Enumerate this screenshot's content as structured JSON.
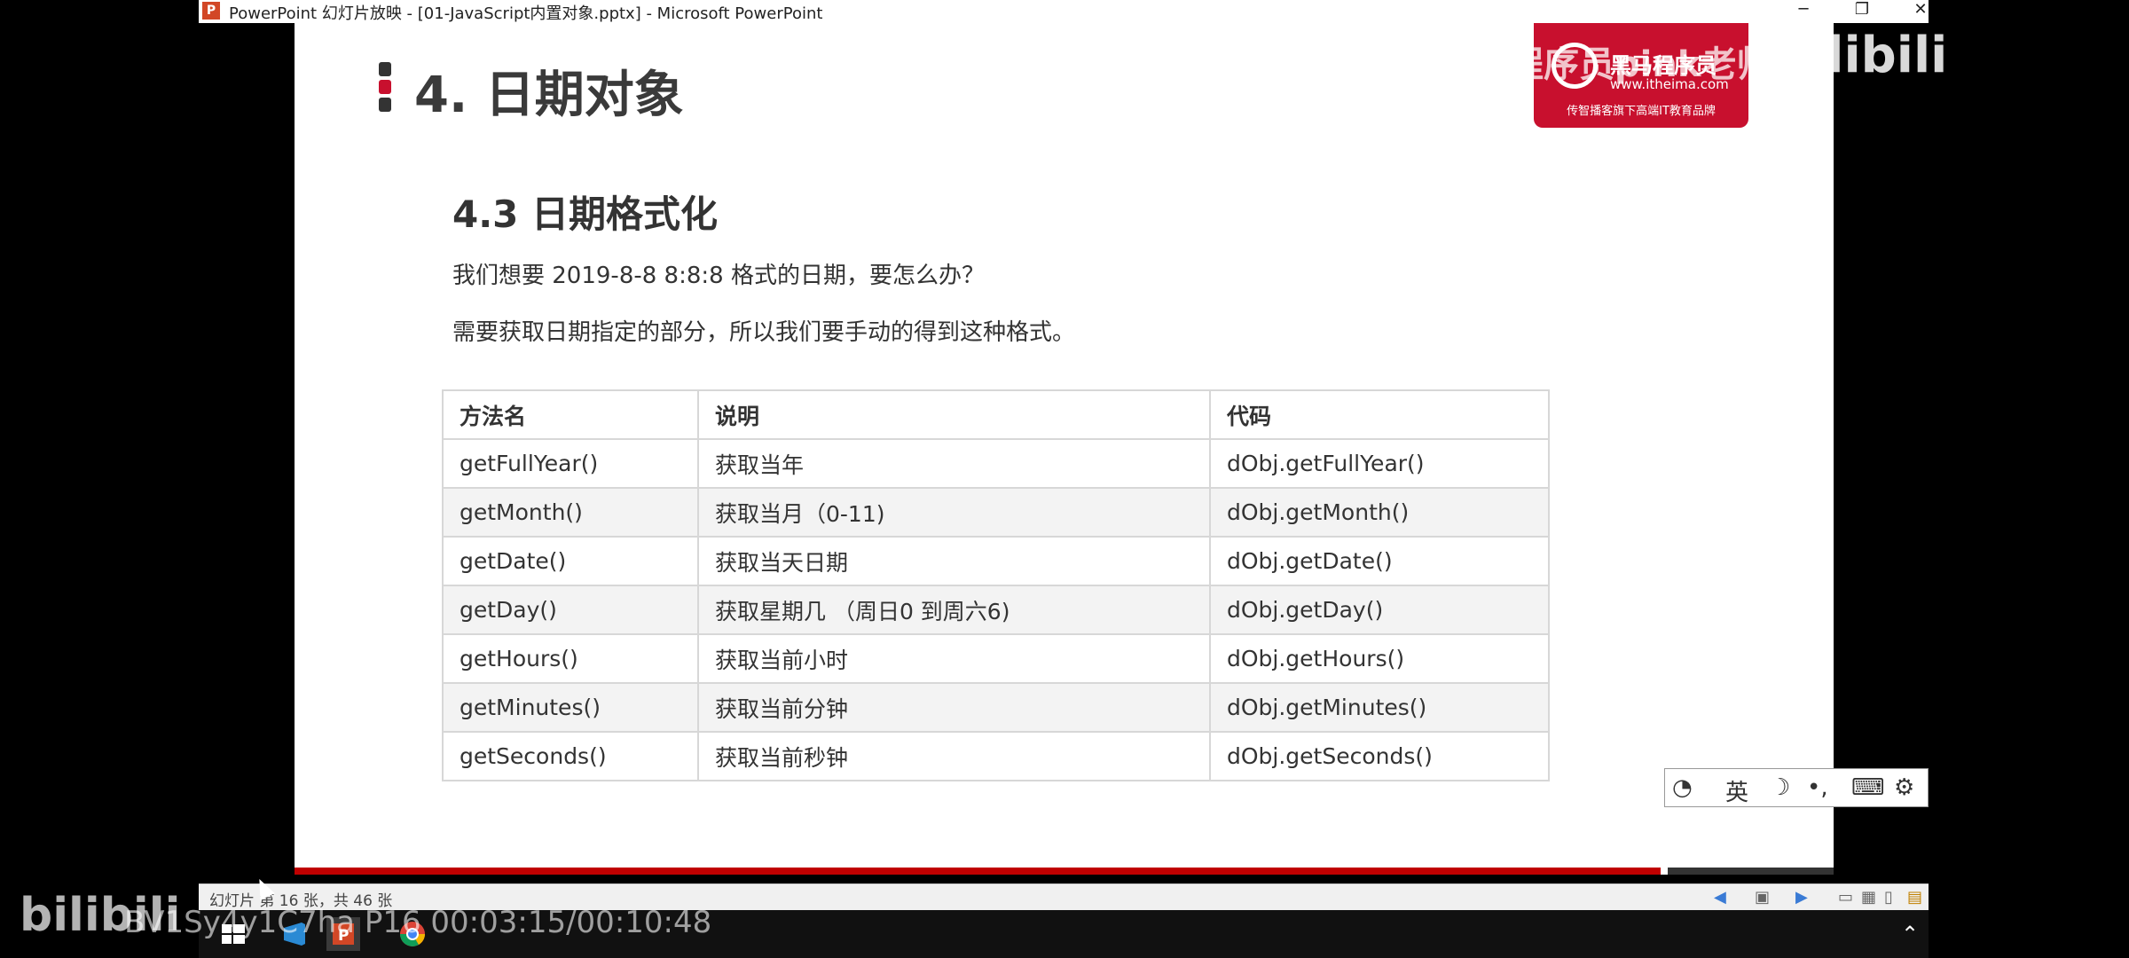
{
  "window": {
    "app_icon": "P",
    "title": "PowerPoint 幻灯片放映 - [01-JavaScript内置对象.pptx] - Microsoft PowerPoint",
    "minimize": "─",
    "restore": "❐",
    "close": "✕"
  },
  "slide": {
    "heading": "4. 日期对象",
    "subheading": "4.3 日期格式化",
    "paragraph1": "我们想要 2019-8-8  8:8:8 格式的日期，要怎么办？",
    "paragraph2": "需要获取日期指定的部分，所以我们要手动的得到这种格式。",
    "table": {
      "headers": [
        "方法名",
        "说明",
        "代码"
      ],
      "rows": [
        [
          "getFullYear()",
          "获取当年",
          "dObj.getFullYear()"
        ],
        [
          "getMonth()",
          "获取当月（0-11)",
          "dObj.getMonth()"
        ],
        [
          "getDate()",
          "获取当天日期",
          "dObj.getDate()"
        ],
        [
          "getDay()",
          "获取星期几 （周日0 到周六6)",
          "dObj.getDay()"
        ],
        [
          "getHours()",
          "获取当前小时",
          "dObj.getHours()"
        ],
        [
          "getMinutes()",
          "获取当前分钟",
          "dObj.getMinutes()"
        ],
        [
          "getSeconds()",
          "获取当前秒钟",
          "dObj.getSeconds()"
        ]
      ]
    }
  },
  "logo": {
    "brand": "黑马程序员",
    "url": "www.itheima.com",
    "slogan": "传智播客旗下高端IT教育品牌"
  },
  "overlay": {
    "watermark": "黑马程序员pink老师",
    "bilibili_top": "bilibili",
    "bilibili_bottom": "bilibili",
    "video_info": "BV1Sy4y1C7ha P16 00:03:15/00:10:48"
  },
  "ime": {
    "lang": "英",
    "moon": "☽",
    "punct": "•,",
    "keyboard": "⌨",
    "settings": "⚙"
  },
  "statusbar": {
    "text": "幻灯片 第 16 张，共 46 张"
  },
  "colors": {
    "accent_red": "#c8102e",
    "slide_bottom_red": "#c00000"
  }
}
